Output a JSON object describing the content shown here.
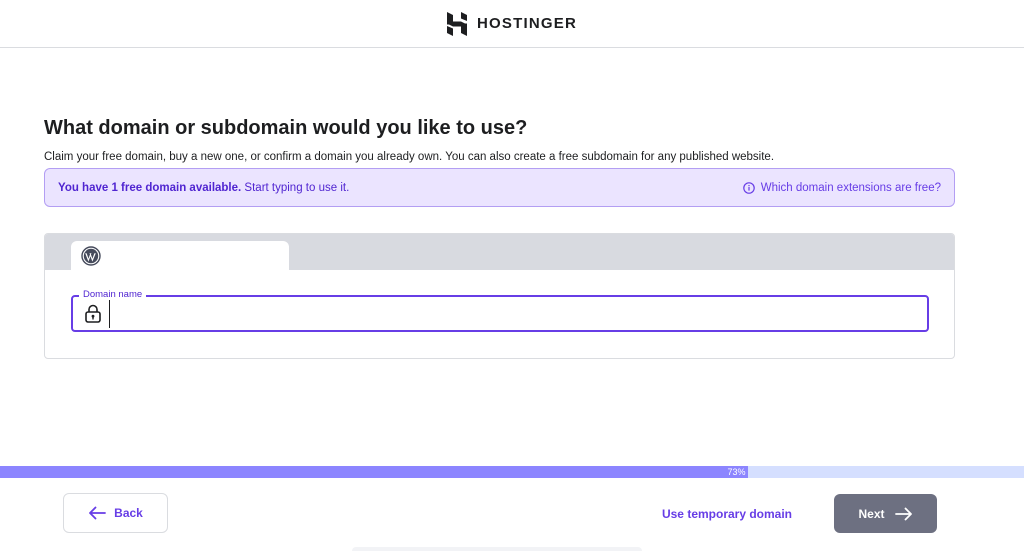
{
  "header": {
    "brand": "HOSTINGER",
    "logo_icon": "hostinger-logo-icon"
  },
  "main": {
    "title": "What domain or subdomain would you like to use?",
    "subtitle": "Claim your free domain, buy a new one, or confirm a domain you already own. You can also create a free subdomain for any published website."
  },
  "banner": {
    "bold_text": "You have 1 free domain available.",
    "text": " Start typing to use it.",
    "link_label": "Which domain extensions are free?",
    "link_icon": "info-icon"
  },
  "domain_card": {
    "tab_icon": "wordpress-icon",
    "field_label": "Domain name",
    "field_value": "",
    "field_icon": "lock-icon"
  },
  "progress": {
    "value_percent": 73,
    "label": "73%"
  },
  "footer": {
    "back_label": "Back",
    "temp_domain_label": "Use temporary domain",
    "next_label": "Next"
  },
  "colors": {
    "accent": "#673de6",
    "banner_bg": "#ebe4ff",
    "progress_fill": "#8c85ff",
    "next_disabled": "#6d7081"
  }
}
